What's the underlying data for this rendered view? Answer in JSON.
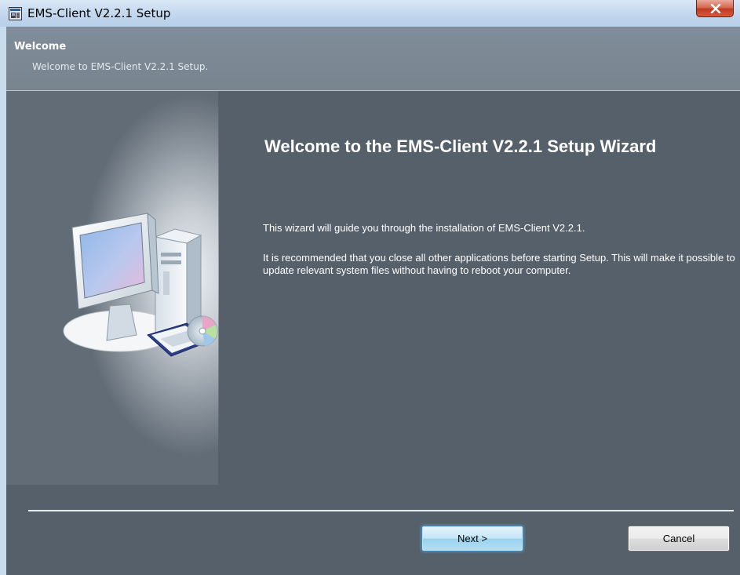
{
  "window": {
    "title": "EMS-Client V2.2.1 Setup",
    "app_icon": "installer-icon",
    "close_icon": "close-icon"
  },
  "header": {
    "title": "Welcome",
    "subtitle": "Welcome to EMS-Client V2.2.1 Setup."
  },
  "side_panel": {
    "image": "computer-illustration"
  },
  "main": {
    "heading": "Welcome to the EMS-Client V2.2.1 Setup Wizard",
    "paragraph1": "This wizard will guide you through the installation of EMS-Client V2.2.1.",
    "paragraph2": "It is recommended that you close all other applications before starting Setup. This will make it possible to update relevant system files without having to reboot your computer."
  },
  "buttons": {
    "next_label": "Next >",
    "cancel_label": "Cancel"
  },
  "colors": {
    "panel_background": "#56606b",
    "header_background": "#808d9a",
    "close_button": "#c23a1f",
    "next_button_accent": "#98d1ef"
  }
}
